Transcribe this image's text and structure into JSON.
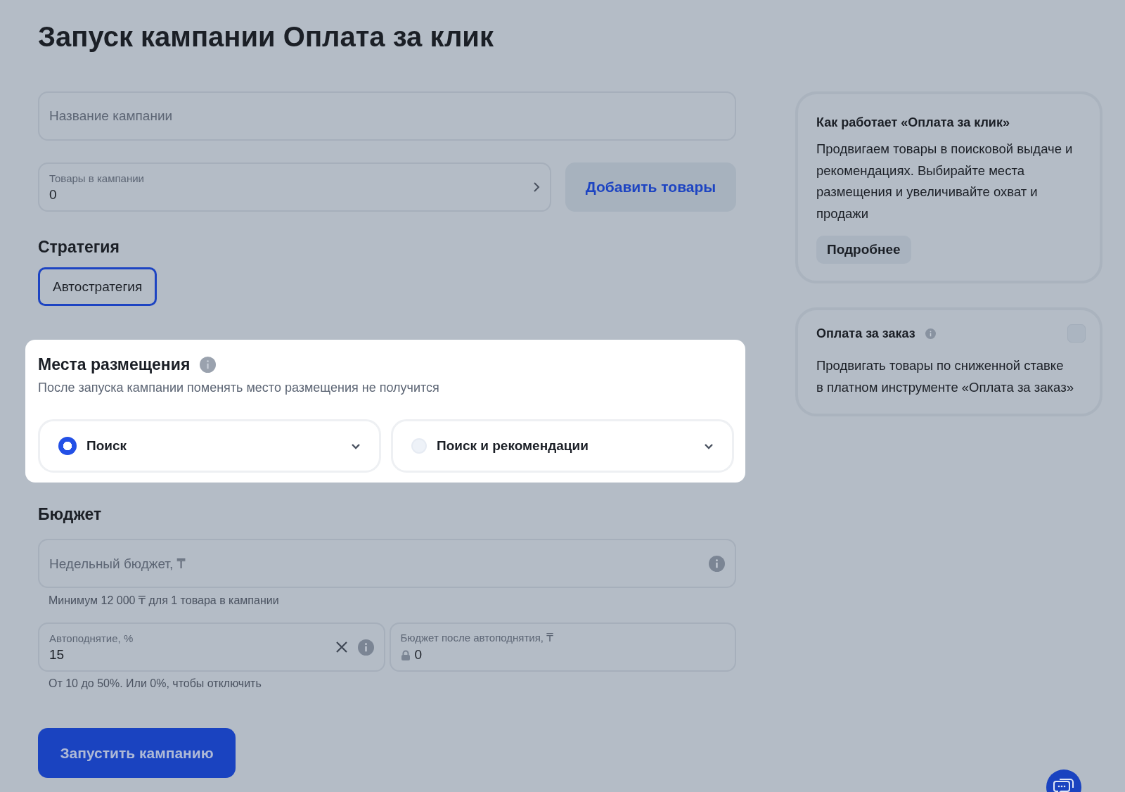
{
  "title": "Запуск кампании Оплата за клик",
  "campaign_name": {
    "placeholder": "Название кампании"
  },
  "products": {
    "label": "Товары в кампании",
    "value": "0",
    "add_button": "Добавить товары"
  },
  "strategy": {
    "heading": "Стратегия",
    "options": [
      {
        "label": "Автостратегия",
        "selected": true
      }
    ]
  },
  "placements": {
    "heading": "Места размещения",
    "note": "После запуска кампании поменять место размещения не получится",
    "options": [
      {
        "label": "Поиск",
        "selected": true
      },
      {
        "label": "Поиск и рекомендации",
        "selected": false
      }
    ]
  },
  "budget": {
    "heading": "Бюджет",
    "weekly": {
      "placeholder": "Недельный бюджет, ₸",
      "hint": "Минимум 12 000 ₸ для 1 товара в кампании"
    },
    "autoraise": {
      "label": "Автоподнятие, %",
      "value": "15",
      "hint": "От 10 до 50%. Или 0%, чтобы отключить"
    },
    "after": {
      "label": "Бюджет после автоподнятия, ₸",
      "value": "0"
    }
  },
  "launch_button": "Запустить кампанию",
  "info_card": {
    "title": "Как работает «Оплата за клик»",
    "text": "Продвигаем товары в поисковой выдаче и рекомендациях. Выбирайте места размещения и увеличивайте охват и продажи",
    "button": "Подробнее"
  },
  "order_card": {
    "title": "Оплата за заказ",
    "checked": false,
    "text": "Продвигать товары по сниженной ставке в платном инструменте «Оплата за заказ»"
  }
}
